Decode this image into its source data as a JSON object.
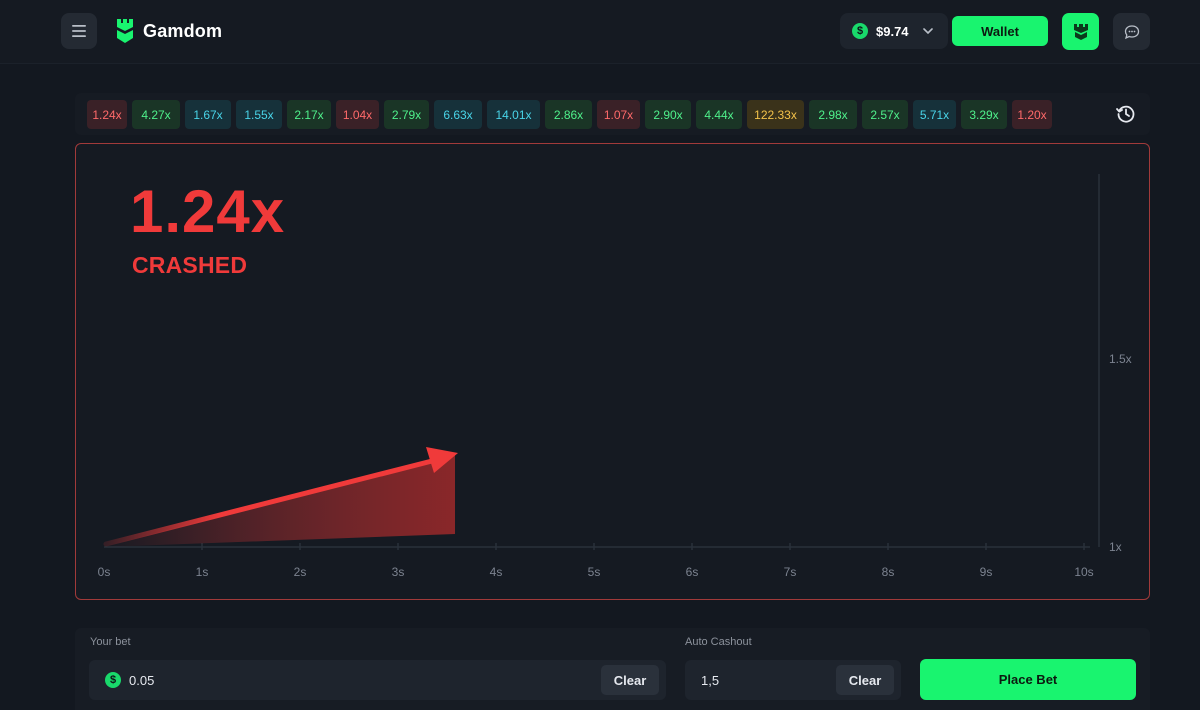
{
  "header": {
    "logo_text": "Gamdom",
    "balance": {
      "currency_symbol": "$",
      "amount": "$9.74"
    },
    "wallet_label": "Wallet",
    "icons": {
      "menu": "hamburger-menu-icon",
      "logo": "gamdom-logo-icon",
      "chevron": "chevron-down-icon",
      "avatar": "user-avatar-icon",
      "chat": "chat-bubble-icon"
    }
  },
  "history": {
    "items": [
      {
        "value": "1.24x",
        "tone": "red"
      },
      {
        "value": "4.27x",
        "tone": "green"
      },
      {
        "value": "1.67x",
        "tone": "teal"
      },
      {
        "value": "1.55x",
        "tone": "teal"
      },
      {
        "value": "2.17x",
        "tone": "green"
      },
      {
        "value": "1.04x",
        "tone": "red"
      },
      {
        "value": "2.79x",
        "tone": "green"
      },
      {
        "value": "6.63x",
        "tone": "teal"
      },
      {
        "value": "14.01x",
        "tone": "teal"
      },
      {
        "value": "2.86x",
        "tone": "green"
      },
      {
        "value": "1.07x",
        "tone": "red"
      },
      {
        "value": "2.90x",
        "tone": "green"
      },
      {
        "value": "4.44x",
        "tone": "green"
      },
      {
        "value": "122.33x",
        "tone": "gold"
      },
      {
        "value": "2.98x",
        "tone": "green"
      },
      {
        "value": "2.57x",
        "tone": "green"
      },
      {
        "value": "5.71x",
        "tone": "teal"
      },
      {
        "value": "3.29x",
        "tone": "green"
      },
      {
        "value": "1.20x",
        "tone": "red"
      }
    ],
    "history_icon": "history-clock-icon"
  },
  "game": {
    "multiplier": "1.24x",
    "status": "CRASHED",
    "x_ticks": [
      "0s",
      "1s",
      "2s",
      "3s",
      "4s",
      "5s",
      "6s",
      "7s",
      "8s",
      "9s",
      "10s"
    ],
    "y_ticks": [
      "1.5x",
      "1x"
    ],
    "crash_time_s": 3.6,
    "crash_multiplier": 1.24,
    "colors": {
      "crash": "#f03a3a",
      "frame": "#a13a3a",
      "accent": "#19f46f"
    }
  },
  "bet": {
    "your_bet_label": "Your bet",
    "bet_value": "0.05",
    "clear_label": "Clear",
    "auto_cashout_label": "Auto Cashout",
    "auto_cashout_value": "1,5",
    "place_bet_label": "Place Bet"
  }
}
